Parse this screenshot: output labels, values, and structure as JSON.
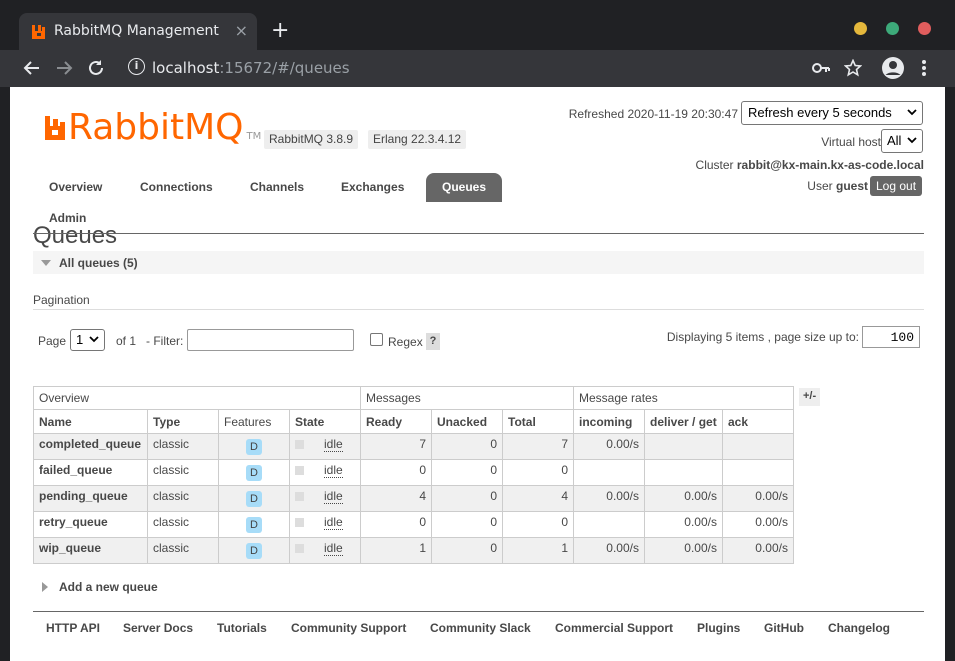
{
  "browser": {
    "tab_title": "RabbitMQ Management",
    "tab_close": "×",
    "new_tab": "+",
    "url_host": "localhost",
    "url_rest": ":15672/#/queues",
    "info_icon": "i",
    "window_controls": {
      "minimize_color": "#e5b83c",
      "maximize_color": "#3daa7a",
      "close_color": "#e05d5d"
    }
  },
  "header": {
    "logo_text": "RabbitMQ",
    "logo_tm": "TM",
    "rabbitmq_version": "RabbitMQ 3.8.9",
    "erlang_version": "Erlang 22.3.4.12",
    "refreshed_label": "Refreshed 2020-11-19 20:30:47",
    "refresh_selected": "Refresh every 5 seconds",
    "vhost_label": "Virtual host",
    "vhost_selected": "All",
    "cluster_label": "Cluster",
    "cluster_name": "rabbit@kx-main.kx-as-code.local",
    "user_label": "User",
    "user_name": "guest",
    "logout_label": "Log out"
  },
  "nav": {
    "overview": "Overview",
    "connections": "Connections",
    "channels": "Channels",
    "exchanges": "Exchanges",
    "queues": "Queues",
    "admin": "Admin"
  },
  "main": {
    "title": "Queues",
    "all_queues_label": "All queues (5)",
    "pagination_label": "Pagination",
    "page_label": "Page",
    "page_selected": "1",
    "of_label": "of 1",
    "filter_label": "- Filter:",
    "filter_value": "",
    "regex_label": "Regex",
    "help_label": "?",
    "displaying_label": "Displaying 5 items , page size up to:",
    "page_size": "100",
    "plusminus_label": "+/-",
    "add_queue_label": "Add a new queue"
  },
  "table": {
    "groups": {
      "overview": "Overview",
      "messages": "Messages",
      "rates": "Message rates"
    },
    "columns": [
      "Name",
      "Type",
      "Features",
      "State",
      "Ready",
      "Unacked",
      "Total",
      "incoming",
      "deliver / get",
      "ack"
    ],
    "rows": [
      {
        "name": "completed_queue",
        "type": "classic",
        "feature": "D",
        "state": "idle",
        "ready": "7",
        "unacked": "0",
        "total": "7",
        "incoming": "0.00/s",
        "deliver": "",
        "ack": ""
      },
      {
        "name": "failed_queue",
        "type": "classic",
        "feature": "D",
        "state": "idle",
        "ready": "0",
        "unacked": "0",
        "total": "0",
        "incoming": "",
        "deliver": "",
        "ack": ""
      },
      {
        "name": "pending_queue",
        "type": "classic",
        "feature": "D",
        "state": "idle",
        "ready": "4",
        "unacked": "0",
        "total": "4",
        "incoming": "0.00/s",
        "deliver": "0.00/s",
        "ack": "0.00/s"
      },
      {
        "name": "retry_queue",
        "type": "classic",
        "feature": "D",
        "state": "idle",
        "ready": "0",
        "unacked": "0",
        "total": "0",
        "incoming": "",
        "deliver": "0.00/s",
        "ack": "0.00/s"
      },
      {
        "name": "wip_queue",
        "type": "classic",
        "feature": "D",
        "state": "idle",
        "ready": "1",
        "unacked": "0",
        "total": "1",
        "incoming": "0.00/s",
        "deliver": "0.00/s",
        "ack": "0.00/s"
      }
    ]
  },
  "footer": {
    "links": [
      "HTTP API",
      "Server Docs",
      "Tutorials",
      "Community Support",
      "Community Slack",
      "Commercial Support",
      "Plugins",
      "GitHub",
      "Changelog"
    ]
  },
  "colors": {
    "brand": "#ff6600",
    "badge": "#a7dcf8",
    "active_tab": "#666666"
  }
}
